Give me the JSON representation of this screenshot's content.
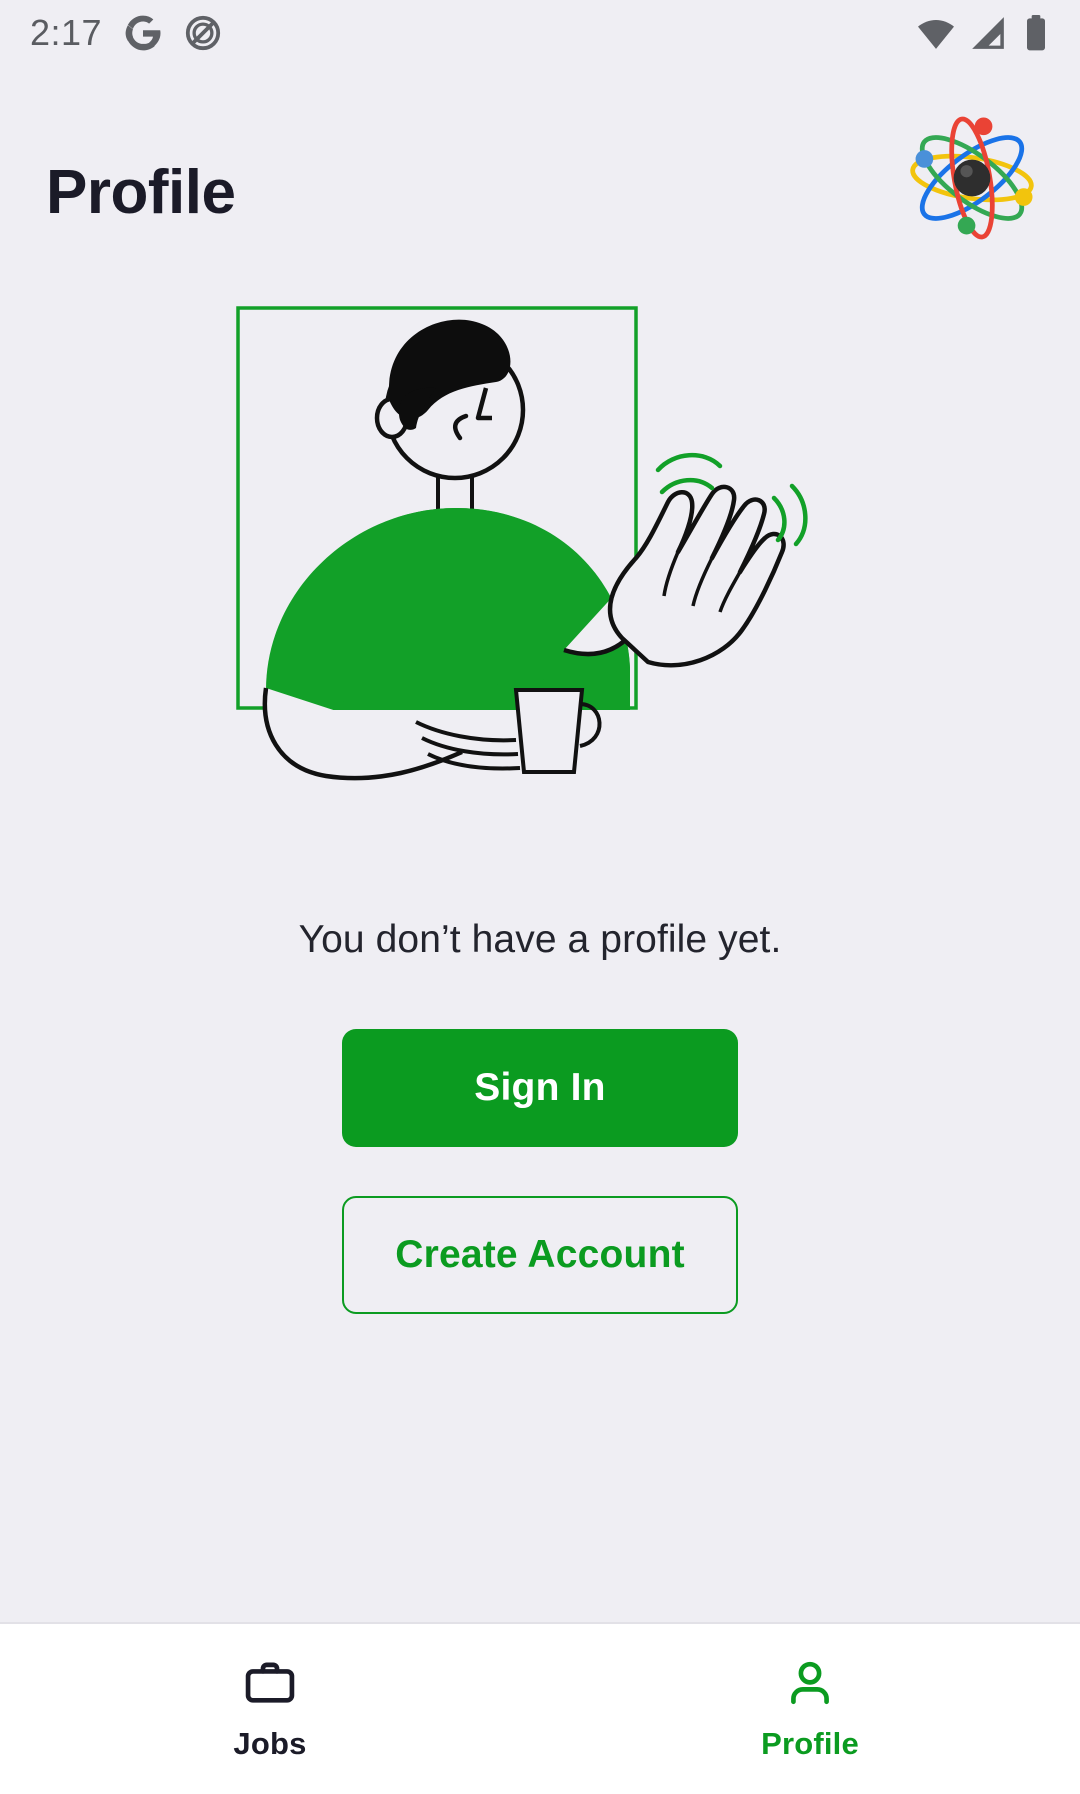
{
  "theme": {
    "background": "#efeef3",
    "brand_green": "#0b9b20",
    "illustration_green": "#12a028",
    "text_dark": "#1b1b28",
    "nav_background": "#ffffff",
    "status_icon_color": "#5f6166"
  },
  "status_bar": {
    "time": "2:17",
    "left_icons": [
      "google-icon",
      "do-not-disturb-icon"
    ],
    "right_icons": [
      "wifi-icon",
      "cellular-signal-icon",
      "battery-icon"
    ]
  },
  "header": {
    "title": "Profile",
    "logo": "atom-logo"
  },
  "main": {
    "illustration": "person-waving-with-mug-illustration",
    "empty_state_text": "You don’t have a profile yet.",
    "primary_button": {
      "label": "Sign In",
      "name": "signin-button"
    },
    "secondary_button": {
      "label": "Create Account",
      "name": "create-account-button"
    }
  },
  "bottom_nav": {
    "items": [
      {
        "label": "Jobs",
        "icon": "briefcase-icon",
        "active": false
      },
      {
        "label": "Profile",
        "icon": "person-icon",
        "active": true
      }
    ]
  }
}
